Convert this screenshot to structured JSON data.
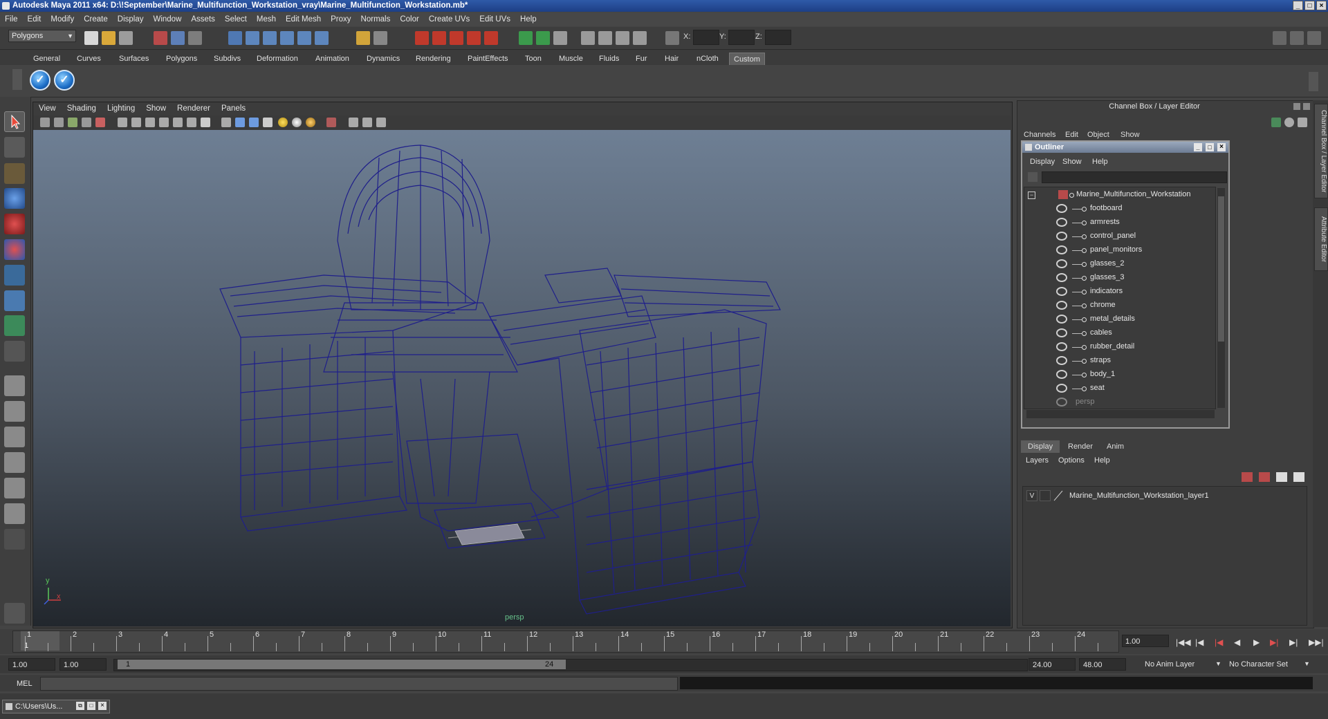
{
  "window": {
    "title": "Autodesk Maya 2011 x64: D:\\!September\\Marine_Multifunction_Workstation_vray\\Marine_Multifunction_Workstation.mb*"
  },
  "menubar": [
    "File",
    "Edit",
    "Modify",
    "Create",
    "Display",
    "Window",
    "Assets",
    "Select",
    "Mesh",
    "Edit Mesh",
    "Proxy",
    "Normals",
    "Color",
    "Create UVs",
    "Edit UVs",
    "Help"
  ],
  "statusline": {
    "mode": "Polygons",
    "coord_labels": [
      "X:",
      "Y:",
      "Z:"
    ]
  },
  "shelf": {
    "tabs": [
      "General",
      "Curves",
      "Surfaces",
      "Polygons",
      "Subdivs",
      "Deformation",
      "Animation",
      "Dynamics",
      "Rendering",
      "PaintEffects",
      "Toon",
      "Muscle",
      "Fluids",
      "Fur",
      "Hair",
      "nCloth",
      "Custom"
    ],
    "active_tab": "Custom"
  },
  "viewport": {
    "menu": [
      "View",
      "Shading",
      "Lighting",
      "Show",
      "Renderer",
      "Panels"
    ],
    "camera": "persp",
    "axis_x": "x",
    "axis_y": "y"
  },
  "channel_box": {
    "title": "Channel Box / Layer Editor",
    "tabs": [
      "Channels",
      "Edit",
      "Object",
      "Show"
    ],
    "side_tabs": [
      "Channel Box / Layer Editor",
      "Attribute Editor"
    ]
  },
  "outliner": {
    "title": "Outliner",
    "menu": [
      "Display",
      "Show",
      "Help"
    ],
    "root": "Marine_Multifunction_Workstation",
    "children": [
      "footboard",
      "armrests",
      "control_panel",
      "panel_monitors",
      "glasses_2",
      "glasses_3",
      "indicators",
      "chrome",
      "metal_details",
      "cables",
      "rubber_detail",
      "straps",
      "body_1",
      "seat"
    ],
    "trailing": "persp"
  },
  "layer_editor": {
    "tabs": [
      "Display",
      "Render",
      "Anim"
    ],
    "active_tab": "Display",
    "menu": [
      "Layers",
      "Options",
      "Help"
    ],
    "layer_visible": "V",
    "layer_name": "Marine_Multifunction_Workstation_layer1"
  },
  "timeslider": {
    "ticks": [
      "1",
      "2",
      "3",
      "4",
      "5",
      "6",
      "7",
      "8",
      "9",
      "10",
      "11",
      "12",
      "13",
      "14",
      "15",
      "16",
      "17",
      "18",
      "19",
      "20",
      "21",
      "22",
      "23",
      "24"
    ],
    "current_frame": "1.00",
    "playhead_label": "1"
  },
  "range": {
    "start": "1.00",
    "inner_start": "1.00",
    "thumb_start": "1",
    "thumb_end": "24",
    "end": "24.00",
    "outer_end": "48.00",
    "anim_layer": "No Anim Layer",
    "char_set": "No Character Set"
  },
  "command": {
    "label": "MEL"
  },
  "taskbar": {
    "item": "C:\\Users\\Us..."
  },
  "colors": {
    "wire": "#1f1f8a",
    "title_bar": "#2f5aa8",
    "grid_label": "#67c28b"
  }
}
